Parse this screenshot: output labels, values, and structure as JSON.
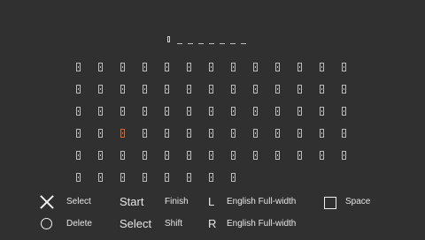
{
  "keyboard": {
    "entry_length": 8,
    "rows": 6,
    "columns": 13,
    "last_row_count": 8,
    "selected_key": {
      "row": 3,
      "column": 2
    }
  },
  "legend": {
    "cross_label": "Select",
    "circle_label": "Delete",
    "start_button": "Start",
    "start_action": "Finish",
    "select_button": "Select",
    "select_action": "Shift",
    "l_button": "L",
    "l_action": "English Full-width",
    "r_button": "R",
    "r_action": "English Full-width",
    "square_label": "Space"
  },
  "colors": {
    "background": "#303030",
    "text": "#e6e6e6",
    "highlight": "#d9672a"
  }
}
